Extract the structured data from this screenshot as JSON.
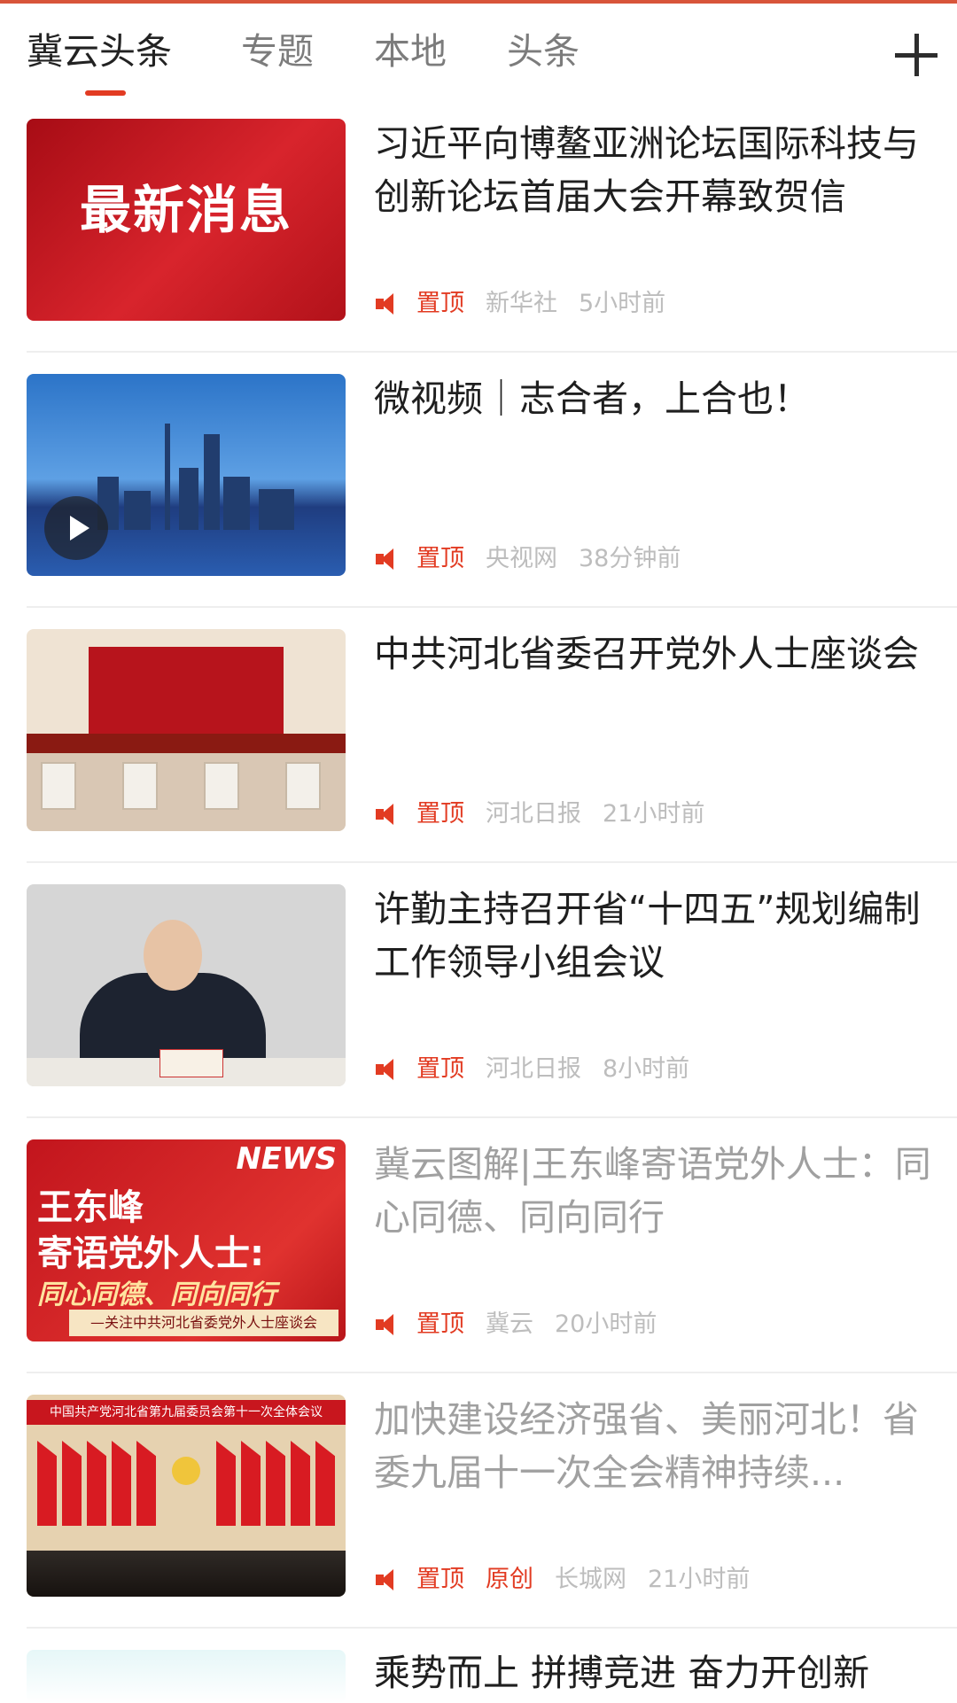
{
  "tabs": [
    {
      "label": "冀云头条",
      "active": true
    },
    {
      "label": "专题",
      "active": false
    },
    {
      "label": "本地",
      "active": false
    },
    {
      "label": "头条",
      "active": false
    }
  ],
  "add_channel_icon": "plus-icon",
  "colors": {
    "accent": "#e23b22",
    "text": "#1f1f1f",
    "meta": "#bdbdbd",
    "read": "#a0a0a0"
  },
  "news": [
    {
      "title": "习近平向博鳌亚洲论坛国际科技与创新论坛首届大会开幕致贺信",
      "thumb_text": "最新消息",
      "pin": "置顶",
      "source": "新华社",
      "time": "5小时前",
      "read": false
    },
    {
      "title": "微视频｜志合者，上合也！",
      "pin": "置顶",
      "source": "央视网",
      "time": "38分钟前",
      "read": false,
      "video": true
    },
    {
      "title": "中共河北省委召开党外人士座谈会",
      "pin": "置顶",
      "source": "河北日报",
      "time": "21小时前",
      "read": false
    },
    {
      "title": "许勤主持召开省“十四五”规划编制工作领导小组会议",
      "pin": "置顶",
      "source": "河北日报",
      "time": "8小时前",
      "read": false
    },
    {
      "title": "冀云图解|王东峰寄语党外人士：同心同德、同向同行",
      "thumb_news": "NEWS",
      "thumb_line1": "王东峰",
      "thumb_line2": "寄语党外人士:",
      "thumb_line3": "同心同德、同向同行",
      "thumb_bar": "—关注中共河北省委党外人士座谈会",
      "pin": "置顶",
      "source": "冀云",
      "time": "20小时前",
      "read": true
    },
    {
      "title": "加快建设经济强省、美丽河北！省委九届十一次全会精神持续...",
      "thumb_banner": "中国共产党河北省第九届委员会第十一次全体会议",
      "pin": "置顶",
      "original": "原创",
      "source": "长城网",
      "time": "21小时前",
      "read": true
    },
    {
      "title": "乘势而上 拼搏竞进 奋力开创新"
    }
  ]
}
